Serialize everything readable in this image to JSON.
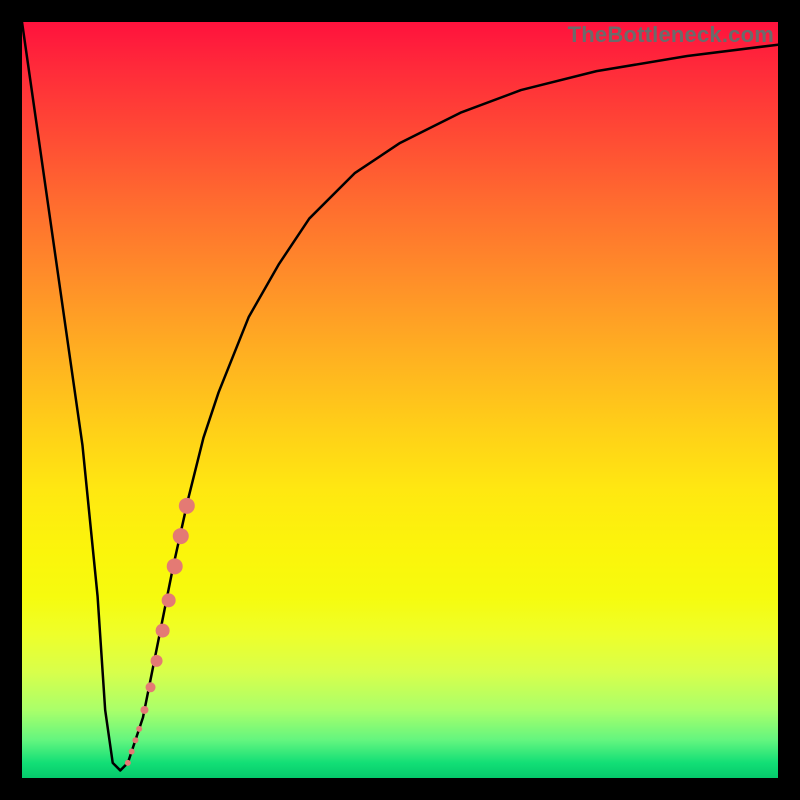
{
  "watermark": "TheBottleneck.com",
  "colors": {
    "curve": "#000000",
    "dots": "#e47a74",
    "frame": "#000000"
  },
  "chart_data": {
    "type": "line",
    "title": "",
    "xlabel": "",
    "ylabel": "",
    "xlim": [
      0,
      100
    ],
    "ylim": [
      0,
      100
    ],
    "grid": false,
    "series": [
      {
        "name": "bottleneck-curve",
        "x": [
          0,
          4,
          8,
          10,
          11,
          12,
          13,
          14,
          16,
          18,
          20,
          22,
          24,
          26,
          30,
          34,
          38,
          44,
          50,
          58,
          66,
          76,
          88,
          100
        ],
        "y": [
          100,
          72,
          44,
          24,
          9,
          2,
          1,
          2,
          8,
          18,
          28,
          37,
          45,
          51,
          61,
          68,
          74,
          80,
          84,
          88,
          91,
          93.5,
          95.5,
          97
        ]
      }
    ],
    "scatter": {
      "name": "sample-dots",
      "points": [
        {
          "x": 14.0,
          "y": 2.0,
          "r": 3
        },
        {
          "x": 14.5,
          "y": 3.5,
          "r": 3
        },
        {
          "x": 15.0,
          "y": 5.0,
          "r": 3
        },
        {
          "x": 15.5,
          "y": 6.5,
          "r": 3
        },
        {
          "x": 16.2,
          "y": 9.0,
          "r": 4
        },
        {
          "x": 17.0,
          "y": 12.0,
          "r": 5
        },
        {
          "x": 17.8,
          "y": 15.5,
          "r": 6
        },
        {
          "x": 18.6,
          "y": 19.5,
          "r": 7
        },
        {
          "x": 19.4,
          "y": 23.5,
          "r": 7
        },
        {
          "x": 20.2,
          "y": 28.0,
          "r": 8
        },
        {
          "x": 21.0,
          "y": 32.0,
          "r": 8
        },
        {
          "x": 21.8,
          "y": 36.0,
          "r": 8
        }
      ]
    }
  }
}
